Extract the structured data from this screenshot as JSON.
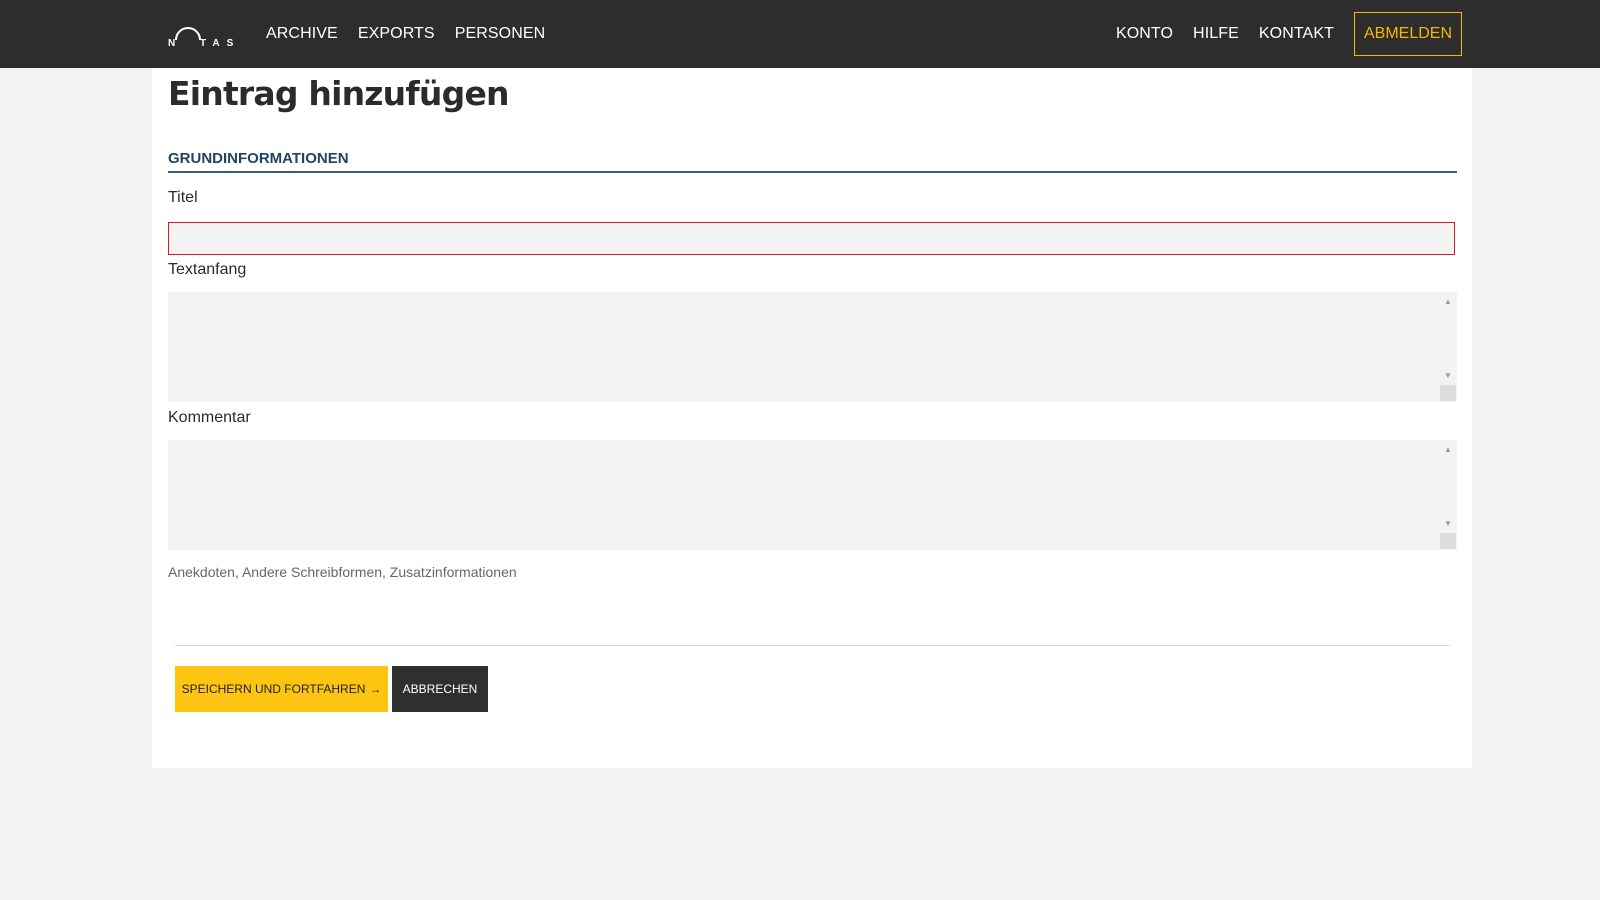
{
  "app": {
    "logo_text": "NOTAS"
  },
  "nav": {
    "left": [
      {
        "label": "ARCHIVE"
      },
      {
        "label": "EXPORTS"
      },
      {
        "label": "PERSONEN"
      }
    ],
    "right": [
      {
        "label": "KONTO"
      },
      {
        "label": "HILFE"
      },
      {
        "label": "KONTAKT"
      }
    ],
    "logout_label": "ABMELDEN"
  },
  "page": {
    "title": "Eintrag hinzufügen"
  },
  "form": {
    "section_title": "GRUNDINFORMATIONEN",
    "fields": {
      "title": {
        "label": "Titel",
        "value": "",
        "invalid": true
      },
      "text_start": {
        "label": "Textanfang",
        "value": ""
      },
      "comment": {
        "label": "Kommentar",
        "value": "",
        "help": "Anekdoten, Andere Schreibformen, Zusatzinformationen"
      }
    }
  },
  "actions": {
    "save_label": "SPEICHERN UND FORTFAHREN",
    "cancel_label": "ABBRECHEN"
  },
  "icons": {
    "save_arrow": "arrow-right-icon",
    "scroll_up": "chevron-up-icon",
    "scroll_down": "chevron-down-icon",
    "resize": "resize-grip-icon"
  },
  "colors": {
    "topbar": "#2d2d2d",
    "accent": "#fdc511",
    "logout_accent": "#f5b800",
    "section": "#1f4466",
    "error": "#cc1e2c"
  }
}
